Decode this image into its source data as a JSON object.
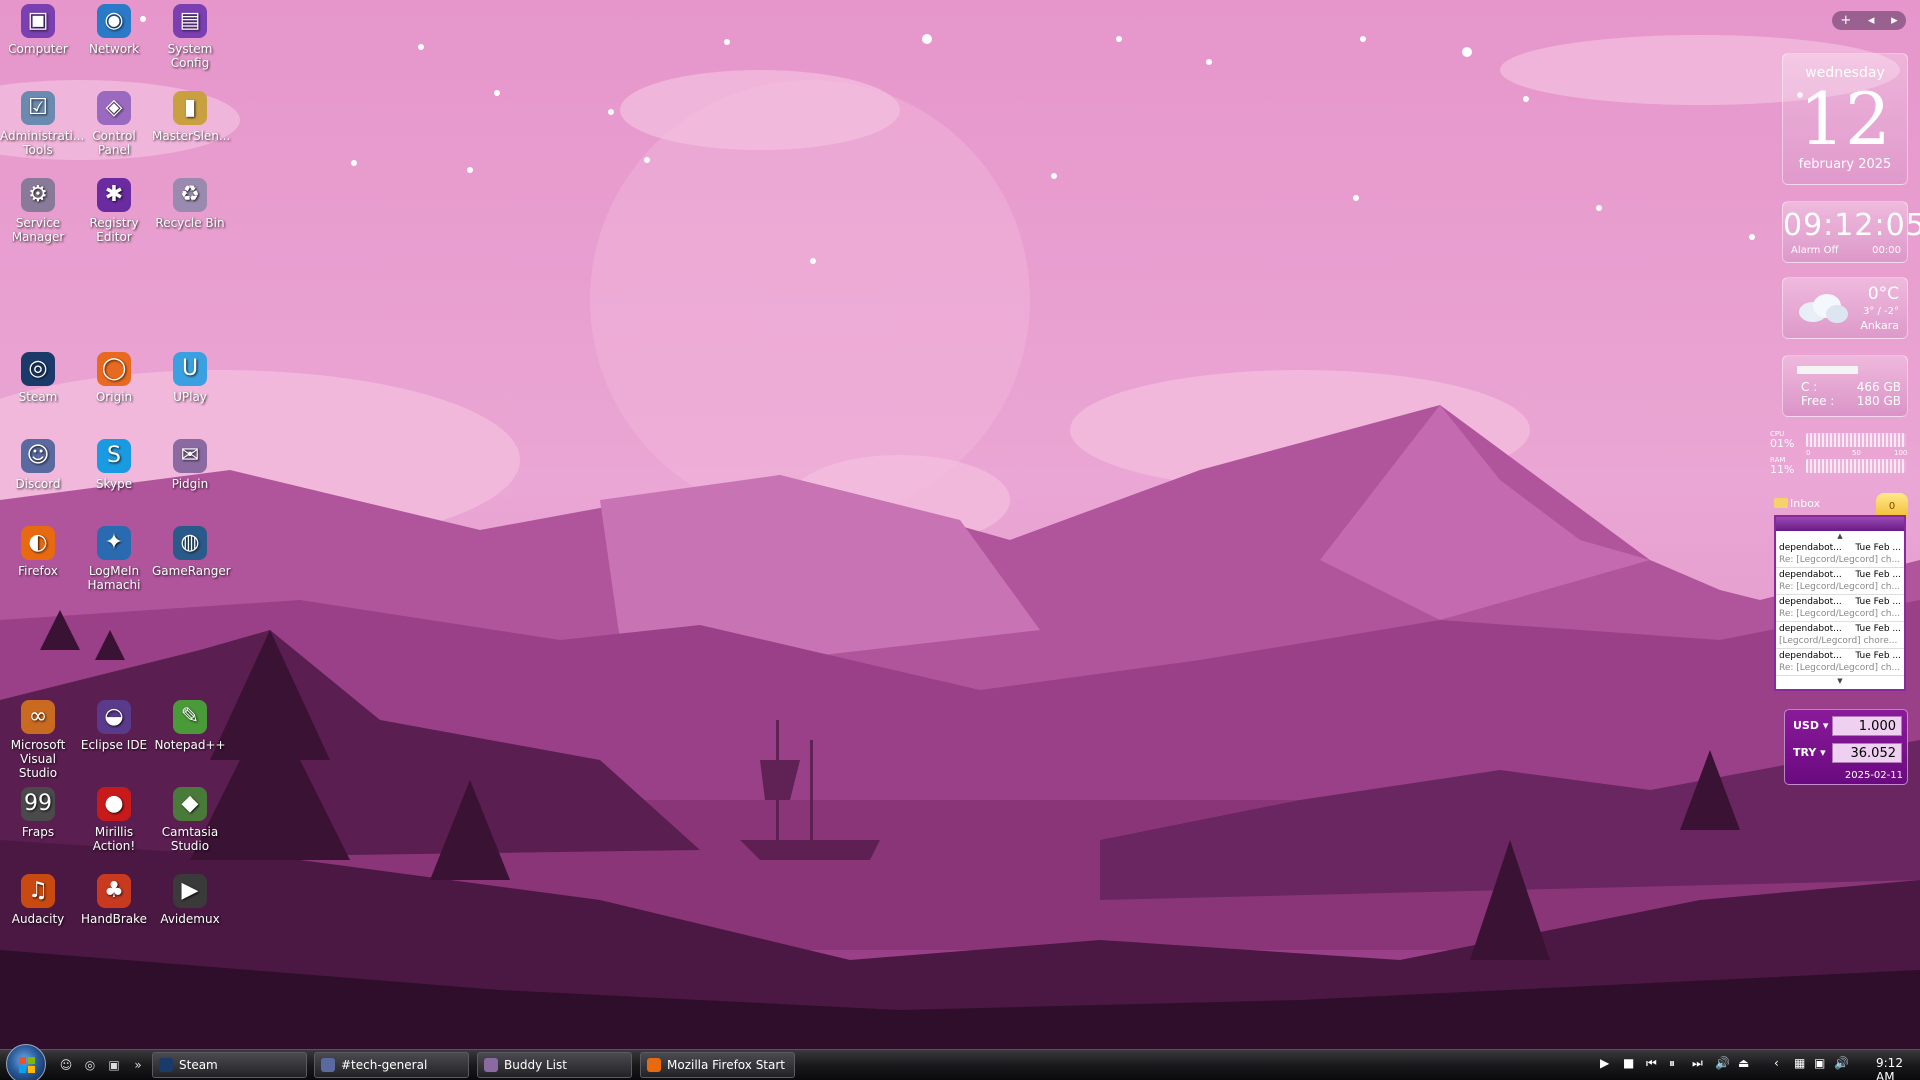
{
  "desktop": {
    "icons": [
      {
        "label": "Computer",
        "glyph": "▣",
        "color": "#7a3fb0"
      },
      {
        "label": "Network",
        "glyph": "◉",
        "color": "#2a7ac8"
      },
      {
        "label": "System\nConfig",
        "glyph": "▤",
        "color": "#7a3fb0"
      },
      {
        "label": "Administrati...\nTools",
        "glyph": "☑",
        "color": "#6a8ab0"
      },
      {
        "label": "Control Panel",
        "glyph": "◈",
        "color": "#9a6ac0"
      },
      {
        "label": "MasterSlen...",
        "glyph": "▮",
        "color": "#c8a040"
      },
      {
        "label": "Service\nManager",
        "glyph": "⚙",
        "color": "#8a7a9a"
      },
      {
        "label": "Registry\nEditor",
        "glyph": "✱",
        "color": "#6a2aa0"
      },
      {
        "label": "Recycle Bin",
        "glyph": "♻",
        "color": "#9a8ab0"
      },
      {
        "label": "Steam",
        "glyph": "◎",
        "color": "#1a3a6a"
      },
      {
        "label": "Origin",
        "glyph": "◯",
        "color": "#e86a20"
      },
      {
        "label": "UPlay",
        "glyph": "U",
        "color": "#3aa0e0"
      },
      {
        "label": "Discord",
        "glyph": "☺",
        "color": "#5a6aa0"
      },
      {
        "label": "Skype",
        "glyph": "S",
        "color": "#1a9ae0"
      },
      {
        "label": "Pidgin",
        "glyph": "✉",
        "color": "#8a6aa0"
      },
      {
        "label": "Firefox",
        "glyph": "◐",
        "color": "#e86a10"
      },
      {
        "label": "LogMeIn\nHamachi",
        "glyph": "✦",
        "color": "#2a6ab0"
      },
      {
        "label": "GameRanger",
        "glyph": "◍",
        "color": "#2a5a8a"
      },
      {
        "label": "Microsoft\nVisual Studio",
        "glyph": "∞",
        "color": "#c86a20"
      },
      {
        "label": "Eclipse IDE",
        "glyph": "◒",
        "color": "#5a3a8a"
      },
      {
        "label": "Notepad++",
        "glyph": "✎",
        "color": "#4a9a3a"
      },
      {
        "label": "Fraps",
        "glyph": "99",
        "color": "#4a4a4a"
      },
      {
        "label": "Mirillis\nAction!",
        "glyph": "●",
        "color": "#c81a1a"
      },
      {
        "label": "Camtasia\nStudio",
        "glyph": "◆",
        "color": "#4a7a3a"
      },
      {
        "label": "Audacity",
        "glyph": "♫",
        "color": "#c84a10"
      },
      {
        "label": "HandBrake",
        "glyph": "♣",
        "color": "#c83a20"
      },
      {
        "label": "Avidemux",
        "glyph": "▶",
        "color": "#3a3a3a"
      }
    ]
  },
  "gadgets": {
    "calendar": {
      "weekday": "wednesday",
      "day": "12",
      "month": "february 2025"
    },
    "clock": {
      "time": "09:12:05",
      "alarm": "Alarm Off",
      "alarm_time": "00:00"
    },
    "weather": {
      "temp": "0°C",
      "range": "3° / -2°",
      "city": "Ankara"
    },
    "drive": {
      "drive_label": "C :",
      "drive_size": "466 GB",
      "free_label": "Free :",
      "free_size": "180 GB",
      "used_fraction": 0.61
    },
    "cpu": {
      "cpu_label": "CPU",
      "cpu_pct": "01%",
      "ram_label": "RAM",
      "ram_pct": "11%",
      "scale": [
        "0",
        "50",
        "100"
      ]
    },
    "mail": {
      "title": "Inbox",
      "unread": "0",
      "items": [
        {
          "from": "dependabot...",
          "date": "Tue Feb ...",
          "subject": "Re: [Legcord/Legcord] ch..."
        },
        {
          "from": "dependabot...",
          "date": "Tue Feb ...",
          "subject": "Re: [Legcord/Legcord] ch..."
        },
        {
          "from": "dependabot...",
          "date": "Tue Feb ...",
          "subject": "Re: [Legcord/Legcord] ch..."
        },
        {
          "from": "dependabot...",
          "date": "Tue Feb ...",
          "subject": "[Legcord/Legcord] chore..."
        },
        {
          "from": "dependabot...",
          "date": "Tue Feb ...",
          "subject": "Re: [Legcord/Legcord] ch..."
        }
      ]
    },
    "currency": {
      "from_code": "USD",
      "from_value": "1.000",
      "to_code": "TRY",
      "to_value": "36.052",
      "date": "2025-02-11"
    }
  },
  "sidebar_controls": {
    "add": "+",
    "prev": "◂",
    "next": "▸"
  },
  "taskbar": {
    "quick_launch": [
      "☺",
      "◎",
      "▣",
      "»"
    ],
    "tasks": [
      {
        "label": "Steam",
        "color": "#1a3a6a"
      },
      {
        "label": "#tech-general",
        "color": "#5a6aa0"
      },
      {
        "label": "Buddy List",
        "color": "#8a6aa0"
      },
      {
        "label": "Mozilla Firefox Start ...",
        "color": "#e86a10"
      }
    ],
    "media_controls": [
      "▶",
      "■",
      "⏮",
      "⏸",
      "⏭",
      "🔊",
      "⏏"
    ],
    "tray_icons": [
      "‹",
      "▦",
      "▣",
      "🔊"
    ],
    "clock": "9:12 AM"
  },
  "colors": {
    "accent": "#8a1a9a",
    "sky": "#e79ccd"
  }
}
